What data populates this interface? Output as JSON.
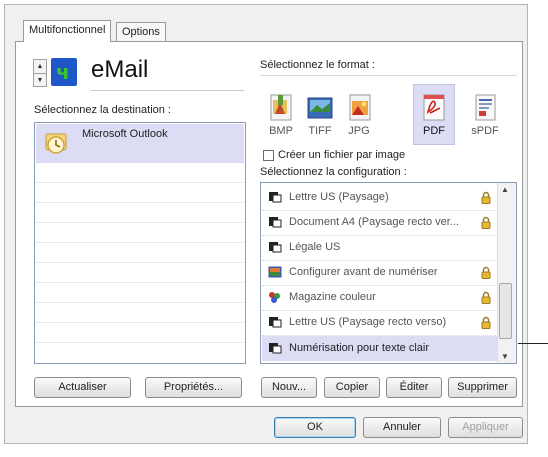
{
  "tabs": [
    {
      "label": "Multifonctionnel",
      "active": true
    },
    {
      "label": "Options",
      "active": false
    }
  ],
  "destination": {
    "name": "eMail",
    "select_label": "Sélectionnez la destination :",
    "items": [
      "Microsoft Outlook"
    ],
    "selected": "Microsoft Outlook"
  },
  "format": {
    "label": "Sélectionnez le format :",
    "options": [
      "BMP",
      "TIFF",
      "JPG",
      "PDF",
      "sPDF"
    ],
    "selected": "PDF",
    "one_file_per_image_label": "Créer un fichier par image",
    "one_file_per_image_checked": false
  },
  "configuration": {
    "label": "Sélectionnez la configuration :",
    "items": [
      "Lettre US (Paysage)",
      "Document A4 (Paysage recto ver...",
      "Légale US",
      "Configurer avant de numériser",
      "Magazine couleur",
      "Lettre US (Paysage recto verso)",
      "Numérisation pour texte clair"
    ],
    "selected": "Numérisation pour texte clair"
  },
  "buttons": {
    "refresh": "Actualiser",
    "properties": "Propriétés...",
    "new": "Nouv...",
    "copy": "Copier",
    "edit": "Éditer",
    "delete": "Supprimer",
    "ok": "OK",
    "cancel": "Annuler",
    "apply": "Appliquer"
  },
  "colors": {
    "selection": "#dcdcf4",
    "email_icon_bg": "#1e56c8",
    "email_icon_fg": "#38c630"
  }
}
